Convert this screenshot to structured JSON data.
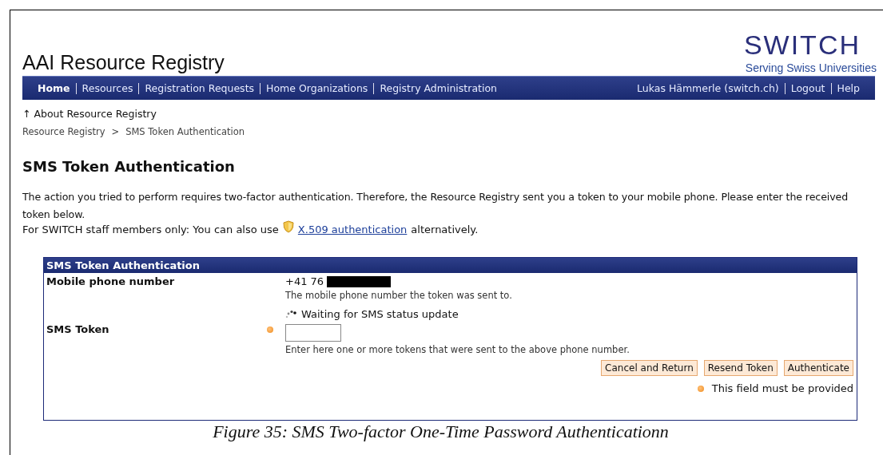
{
  "header": {
    "title": "AAI Resource Registry",
    "logo": "SWITCH",
    "tagline": "Serving Swiss Universities"
  },
  "nav": {
    "left": [
      {
        "label": "Home",
        "selected": true
      },
      {
        "label": "Resources",
        "selected": false
      },
      {
        "label": "Registration Requests",
        "selected": false
      },
      {
        "label": "Home Organizations",
        "selected": false
      },
      {
        "label": "Registry Administration",
        "selected": false
      }
    ],
    "right": [
      "Lukas Hämmerle (switch.ch)",
      "Logout",
      "Help"
    ]
  },
  "up_link": "↑ About Resource Registry",
  "breadcrumb": {
    "items": [
      "Resource Registry",
      "SMS Token Authentication"
    ],
    "separator": ">"
  },
  "heading": "SMS Token Authentication",
  "intro": "The action you tried to perform requires two-factor authentication. Therefore, the Resource Registry sent you a token to your mobile phone. Please enter the received token below.",
  "staff_note": {
    "before": "For SWITCH staff members only: You can also use",
    "link": "X.509 authentication",
    "after": "alternatively."
  },
  "form": {
    "title": "SMS Token Authentication",
    "phone": {
      "label": "Mobile phone number",
      "value": "+41 76",
      "redacted": true,
      "hint": "The mobile phone number the token was sent to.",
      "status": "Waiting for SMS status update"
    },
    "token": {
      "label": "SMS Token",
      "required": true,
      "hint": "Enter here one or more tokens that were sent to the above phone number."
    },
    "buttons": [
      "Cancel and Return",
      "Resend Token",
      "Authenticate"
    ],
    "required_note": "This field must be provided"
  },
  "caption": "Figure 35: SMS Two-factor One-Time Password Authenticationn"
}
